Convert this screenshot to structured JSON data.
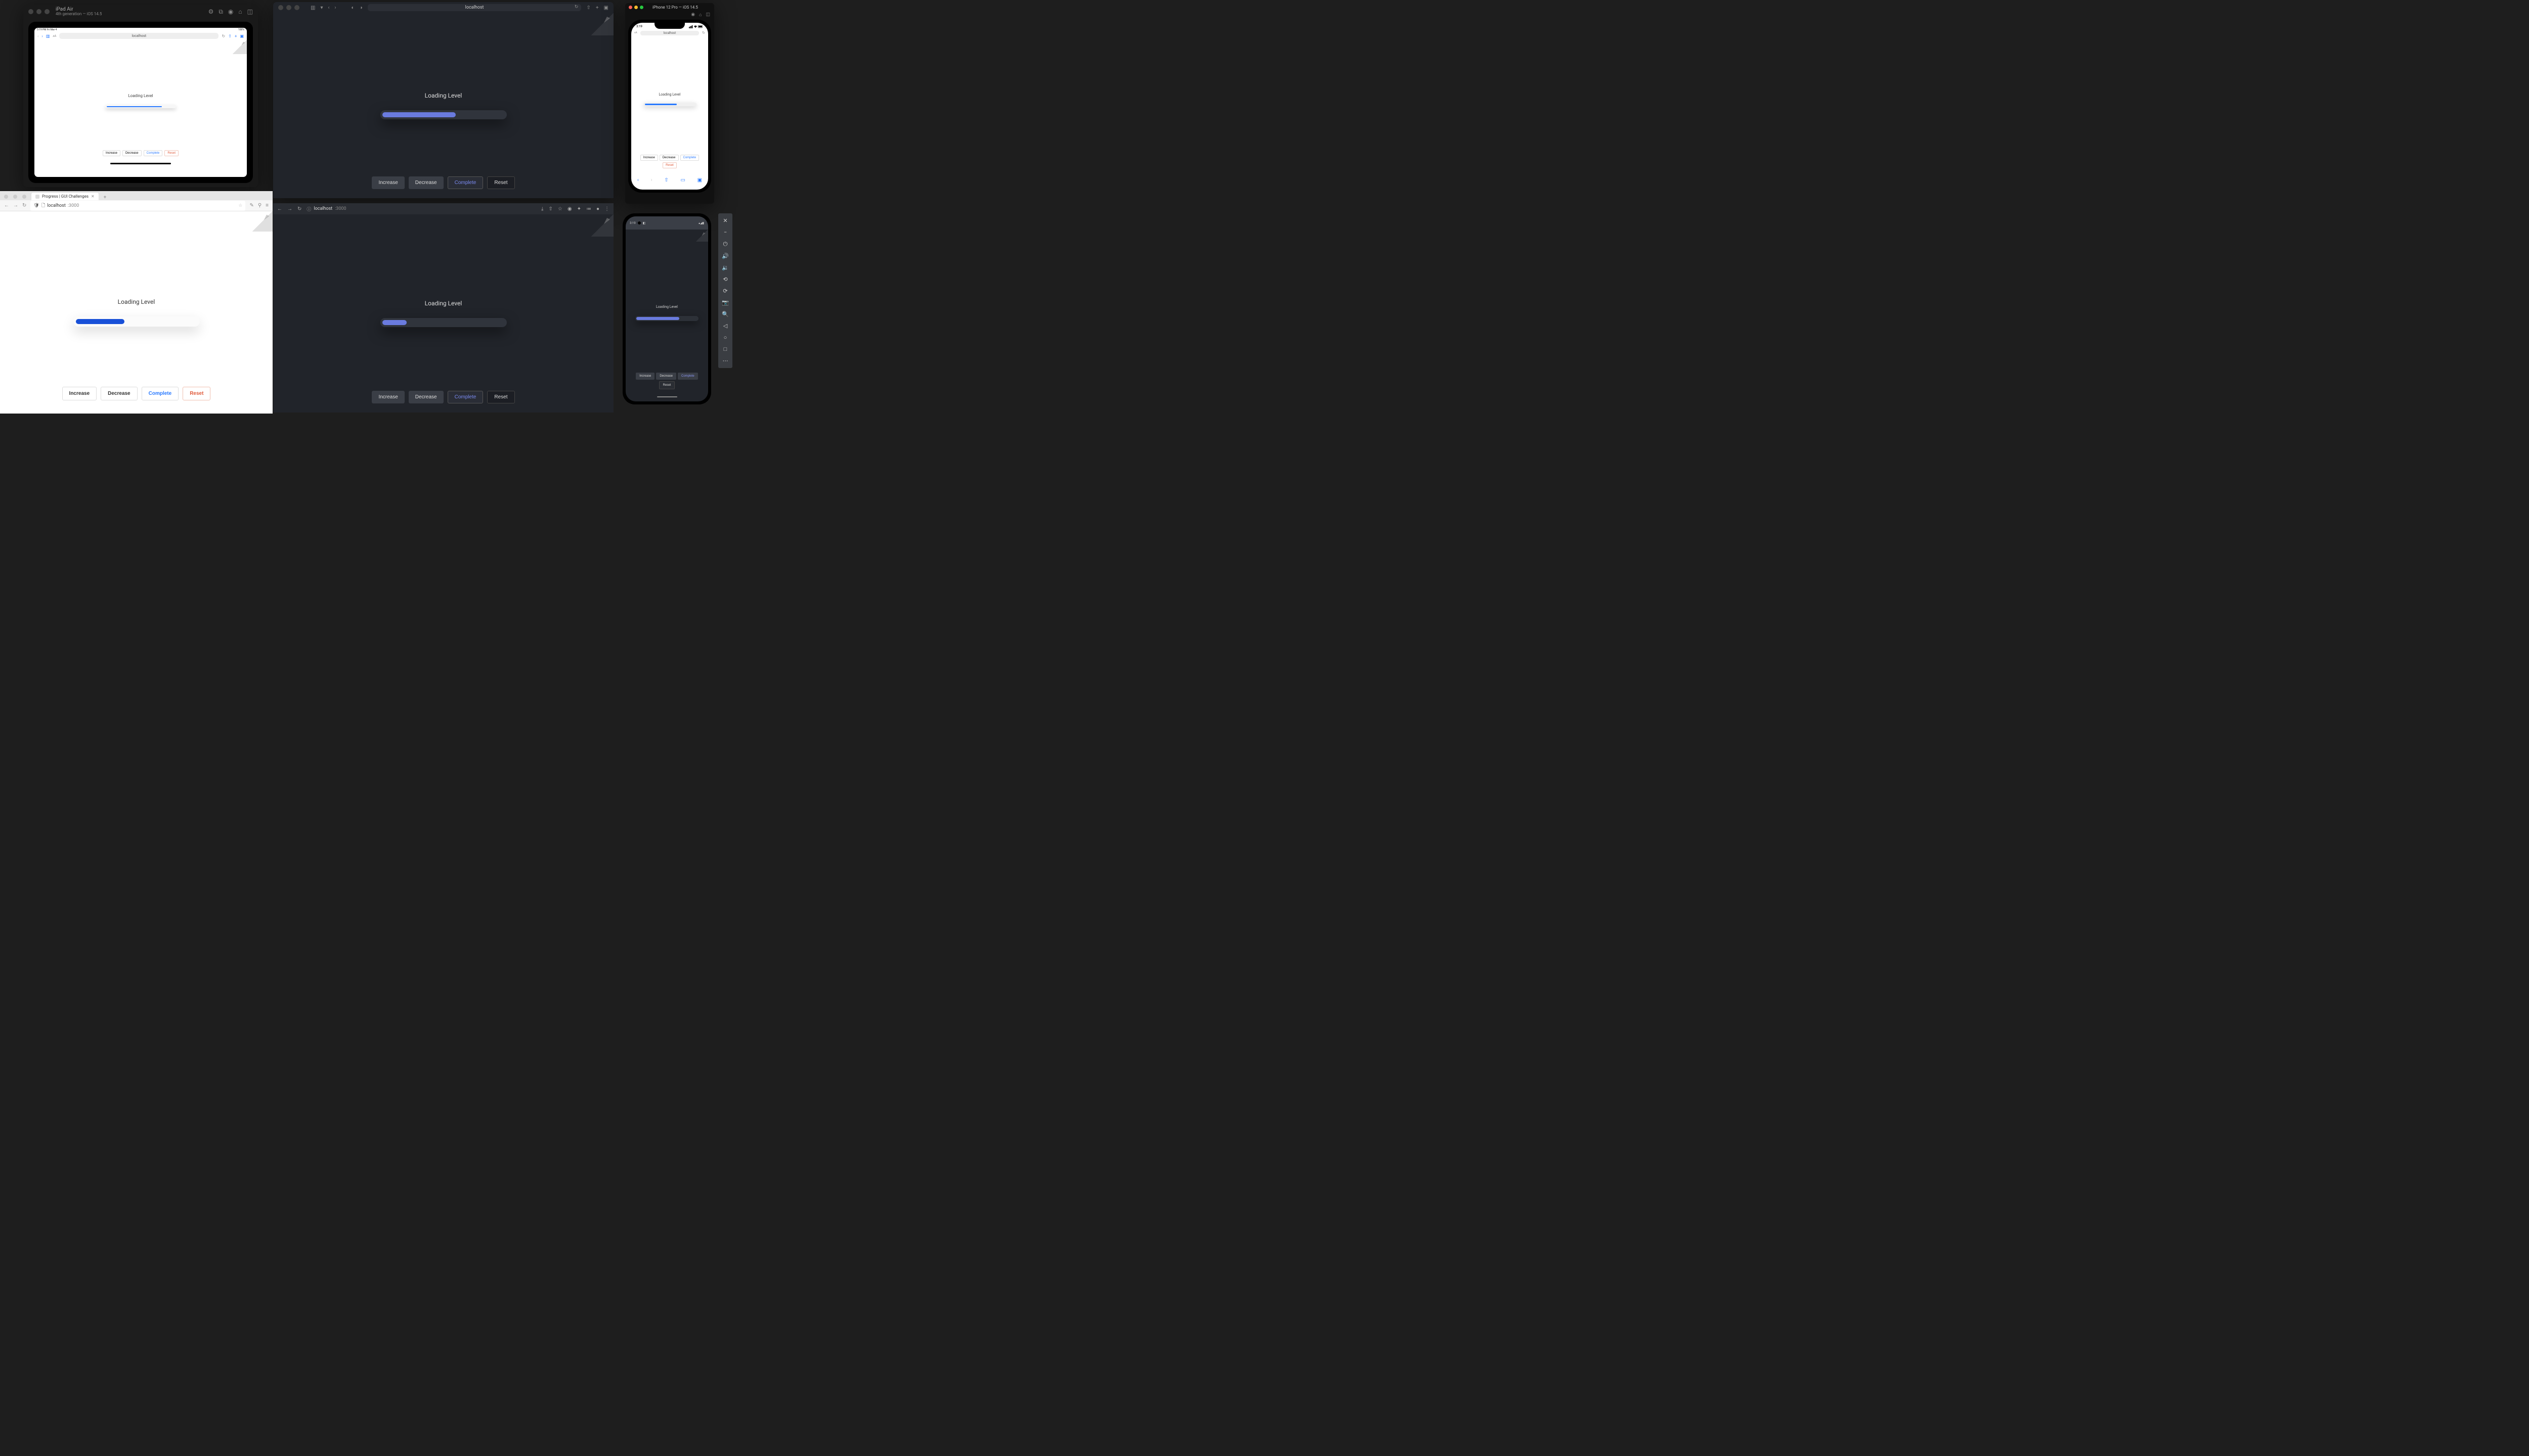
{
  "app_label": "Loading Level",
  "buttons": {
    "increase": "Increase",
    "decrease": "Decrease",
    "complete": "Complete",
    "reset": "Reset"
  },
  "ipad_sim": {
    "title": "iPad Air",
    "subtitle": "4th generation — iOS 14.5",
    "status_left": "3:19 PM  Fri Mar 4",
    "status_right": "100%",
    "url": "localhost"
  },
  "safari_desktop": {
    "url": "localhost"
  },
  "iphone_sim": {
    "title": "iPhone 12 Pro — iOS 14.5",
    "time": "3:19",
    "url": "localhost"
  },
  "firefox": {
    "tab_title": "Progress | GUI Challenges",
    "url_host": "localhost",
    "url_port": ":3000"
  },
  "chrome": {
    "url_host": "localhost",
    "url_port": ":3000"
  },
  "android": {
    "time": "3:19"
  }
}
